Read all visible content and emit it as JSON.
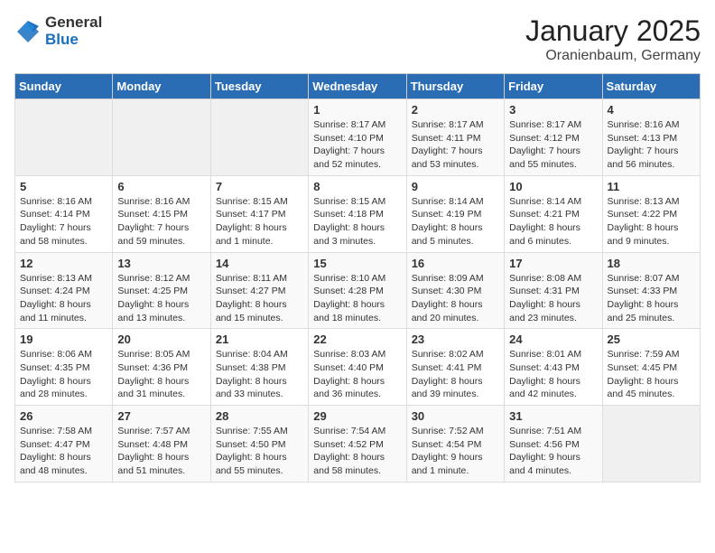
{
  "logo": {
    "general": "General",
    "blue": "Blue"
  },
  "header": {
    "month": "January 2025",
    "location": "Oranienbaum, Germany"
  },
  "days_of_week": [
    "Sunday",
    "Monday",
    "Tuesday",
    "Wednesday",
    "Thursday",
    "Friday",
    "Saturday"
  ],
  "weeks": [
    [
      {
        "day": "",
        "info": ""
      },
      {
        "day": "",
        "info": ""
      },
      {
        "day": "",
        "info": ""
      },
      {
        "day": "1",
        "info": "Sunrise: 8:17 AM\nSunset: 4:10 PM\nDaylight: 7 hours\nand 52 minutes."
      },
      {
        "day": "2",
        "info": "Sunrise: 8:17 AM\nSunset: 4:11 PM\nDaylight: 7 hours\nand 53 minutes."
      },
      {
        "day": "3",
        "info": "Sunrise: 8:17 AM\nSunset: 4:12 PM\nDaylight: 7 hours\nand 55 minutes."
      },
      {
        "day": "4",
        "info": "Sunrise: 8:16 AM\nSunset: 4:13 PM\nDaylight: 7 hours\nand 56 minutes."
      }
    ],
    [
      {
        "day": "5",
        "info": "Sunrise: 8:16 AM\nSunset: 4:14 PM\nDaylight: 7 hours\nand 58 minutes."
      },
      {
        "day": "6",
        "info": "Sunrise: 8:16 AM\nSunset: 4:15 PM\nDaylight: 7 hours\nand 59 minutes."
      },
      {
        "day": "7",
        "info": "Sunrise: 8:15 AM\nSunset: 4:17 PM\nDaylight: 8 hours\nand 1 minute."
      },
      {
        "day": "8",
        "info": "Sunrise: 8:15 AM\nSunset: 4:18 PM\nDaylight: 8 hours\nand 3 minutes."
      },
      {
        "day": "9",
        "info": "Sunrise: 8:14 AM\nSunset: 4:19 PM\nDaylight: 8 hours\nand 5 minutes."
      },
      {
        "day": "10",
        "info": "Sunrise: 8:14 AM\nSunset: 4:21 PM\nDaylight: 8 hours\nand 6 minutes."
      },
      {
        "day": "11",
        "info": "Sunrise: 8:13 AM\nSunset: 4:22 PM\nDaylight: 8 hours\nand 9 minutes."
      }
    ],
    [
      {
        "day": "12",
        "info": "Sunrise: 8:13 AM\nSunset: 4:24 PM\nDaylight: 8 hours\nand 11 minutes."
      },
      {
        "day": "13",
        "info": "Sunrise: 8:12 AM\nSunset: 4:25 PM\nDaylight: 8 hours\nand 13 minutes."
      },
      {
        "day": "14",
        "info": "Sunrise: 8:11 AM\nSunset: 4:27 PM\nDaylight: 8 hours\nand 15 minutes."
      },
      {
        "day": "15",
        "info": "Sunrise: 8:10 AM\nSunset: 4:28 PM\nDaylight: 8 hours\nand 18 minutes."
      },
      {
        "day": "16",
        "info": "Sunrise: 8:09 AM\nSunset: 4:30 PM\nDaylight: 8 hours\nand 20 minutes."
      },
      {
        "day": "17",
        "info": "Sunrise: 8:08 AM\nSunset: 4:31 PM\nDaylight: 8 hours\nand 23 minutes."
      },
      {
        "day": "18",
        "info": "Sunrise: 8:07 AM\nSunset: 4:33 PM\nDaylight: 8 hours\nand 25 minutes."
      }
    ],
    [
      {
        "day": "19",
        "info": "Sunrise: 8:06 AM\nSunset: 4:35 PM\nDaylight: 8 hours\nand 28 minutes."
      },
      {
        "day": "20",
        "info": "Sunrise: 8:05 AM\nSunset: 4:36 PM\nDaylight: 8 hours\nand 31 minutes."
      },
      {
        "day": "21",
        "info": "Sunrise: 8:04 AM\nSunset: 4:38 PM\nDaylight: 8 hours\nand 33 minutes."
      },
      {
        "day": "22",
        "info": "Sunrise: 8:03 AM\nSunset: 4:40 PM\nDaylight: 8 hours\nand 36 minutes."
      },
      {
        "day": "23",
        "info": "Sunrise: 8:02 AM\nSunset: 4:41 PM\nDaylight: 8 hours\nand 39 minutes."
      },
      {
        "day": "24",
        "info": "Sunrise: 8:01 AM\nSunset: 4:43 PM\nDaylight: 8 hours\nand 42 minutes."
      },
      {
        "day": "25",
        "info": "Sunrise: 7:59 AM\nSunset: 4:45 PM\nDaylight: 8 hours\nand 45 minutes."
      }
    ],
    [
      {
        "day": "26",
        "info": "Sunrise: 7:58 AM\nSunset: 4:47 PM\nDaylight: 8 hours\nand 48 minutes."
      },
      {
        "day": "27",
        "info": "Sunrise: 7:57 AM\nSunset: 4:48 PM\nDaylight: 8 hours\nand 51 minutes."
      },
      {
        "day": "28",
        "info": "Sunrise: 7:55 AM\nSunset: 4:50 PM\nDaylight: 8 hours\nand 55 minutes."
      },
      {
        "day": "29",
        "info": "Sunrise: 7:54 AM\nSunset: 4:52 PM\nDaylight: 8 hours\nand 58 minutes."
      },
      {
        "day": "30",
        "info": "Sunrise: 7:52 AM\nSunset: 4:54 PM\nDaylight: 9 hours\nand 1 minute."
      },
      {
        "day": "31",
        "info": "Sunrise: 7:51 AM\nSunset: 4:56 PM\nDaylight: 9 hours\nand 4 minutes."
      },
      {
        "day": "",
        "info": ""
      }
    ]
  ]
}
